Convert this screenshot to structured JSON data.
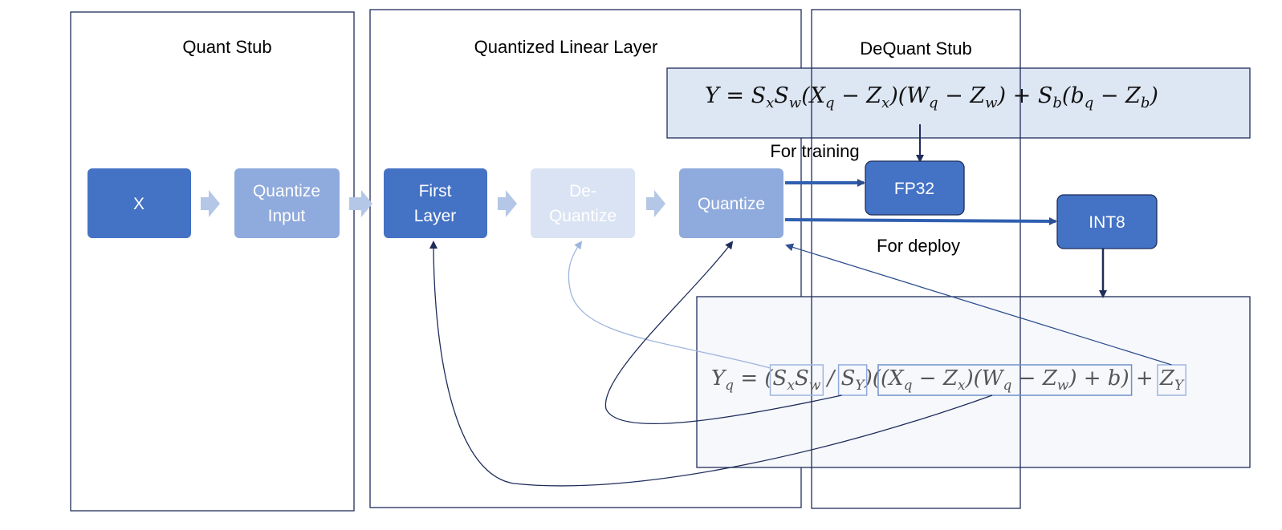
{
  "regions": {
    "quant_stub": "Quant Stub",
    "quantized_linear_layer": "Quantized Linear Layer",
    "dequant_stub": "DeQuant Stub"
  },
  "nodes": {
    "x": "X",
    "quantize_input": [
      "Quantize",
      "Input"
    ],
    "first_layer": [
      "First",
      "Layer"
    ],
    "dequantize": [
      "De-",
      "Quantize"
    ],
    "quantize": "Quantize",
    "fp32": "FP32",
    "int8": "INT8"
  },
  "labels": {
    "for_training": "For training",
    "for_deploy": "For deploy"
  },
  "formulas": {
    "training": "Y = SxSw(Xq − Zx)(Wq − Zw) + Sb(bq − Zb)",
    "deploy": "Yq = (SxSw / SY)((Xq − Zx)(Wq − Zw) + b) + ZY"
  },
  "colors": {
    "dark_blue": "#4472c4",
    "mid_blue": "#8faadc",
    "light_blue": "#dae3f3",
    "arrow_blue": "#b4c7e7",
    "curve": "#1f2d5a"
  }
}
